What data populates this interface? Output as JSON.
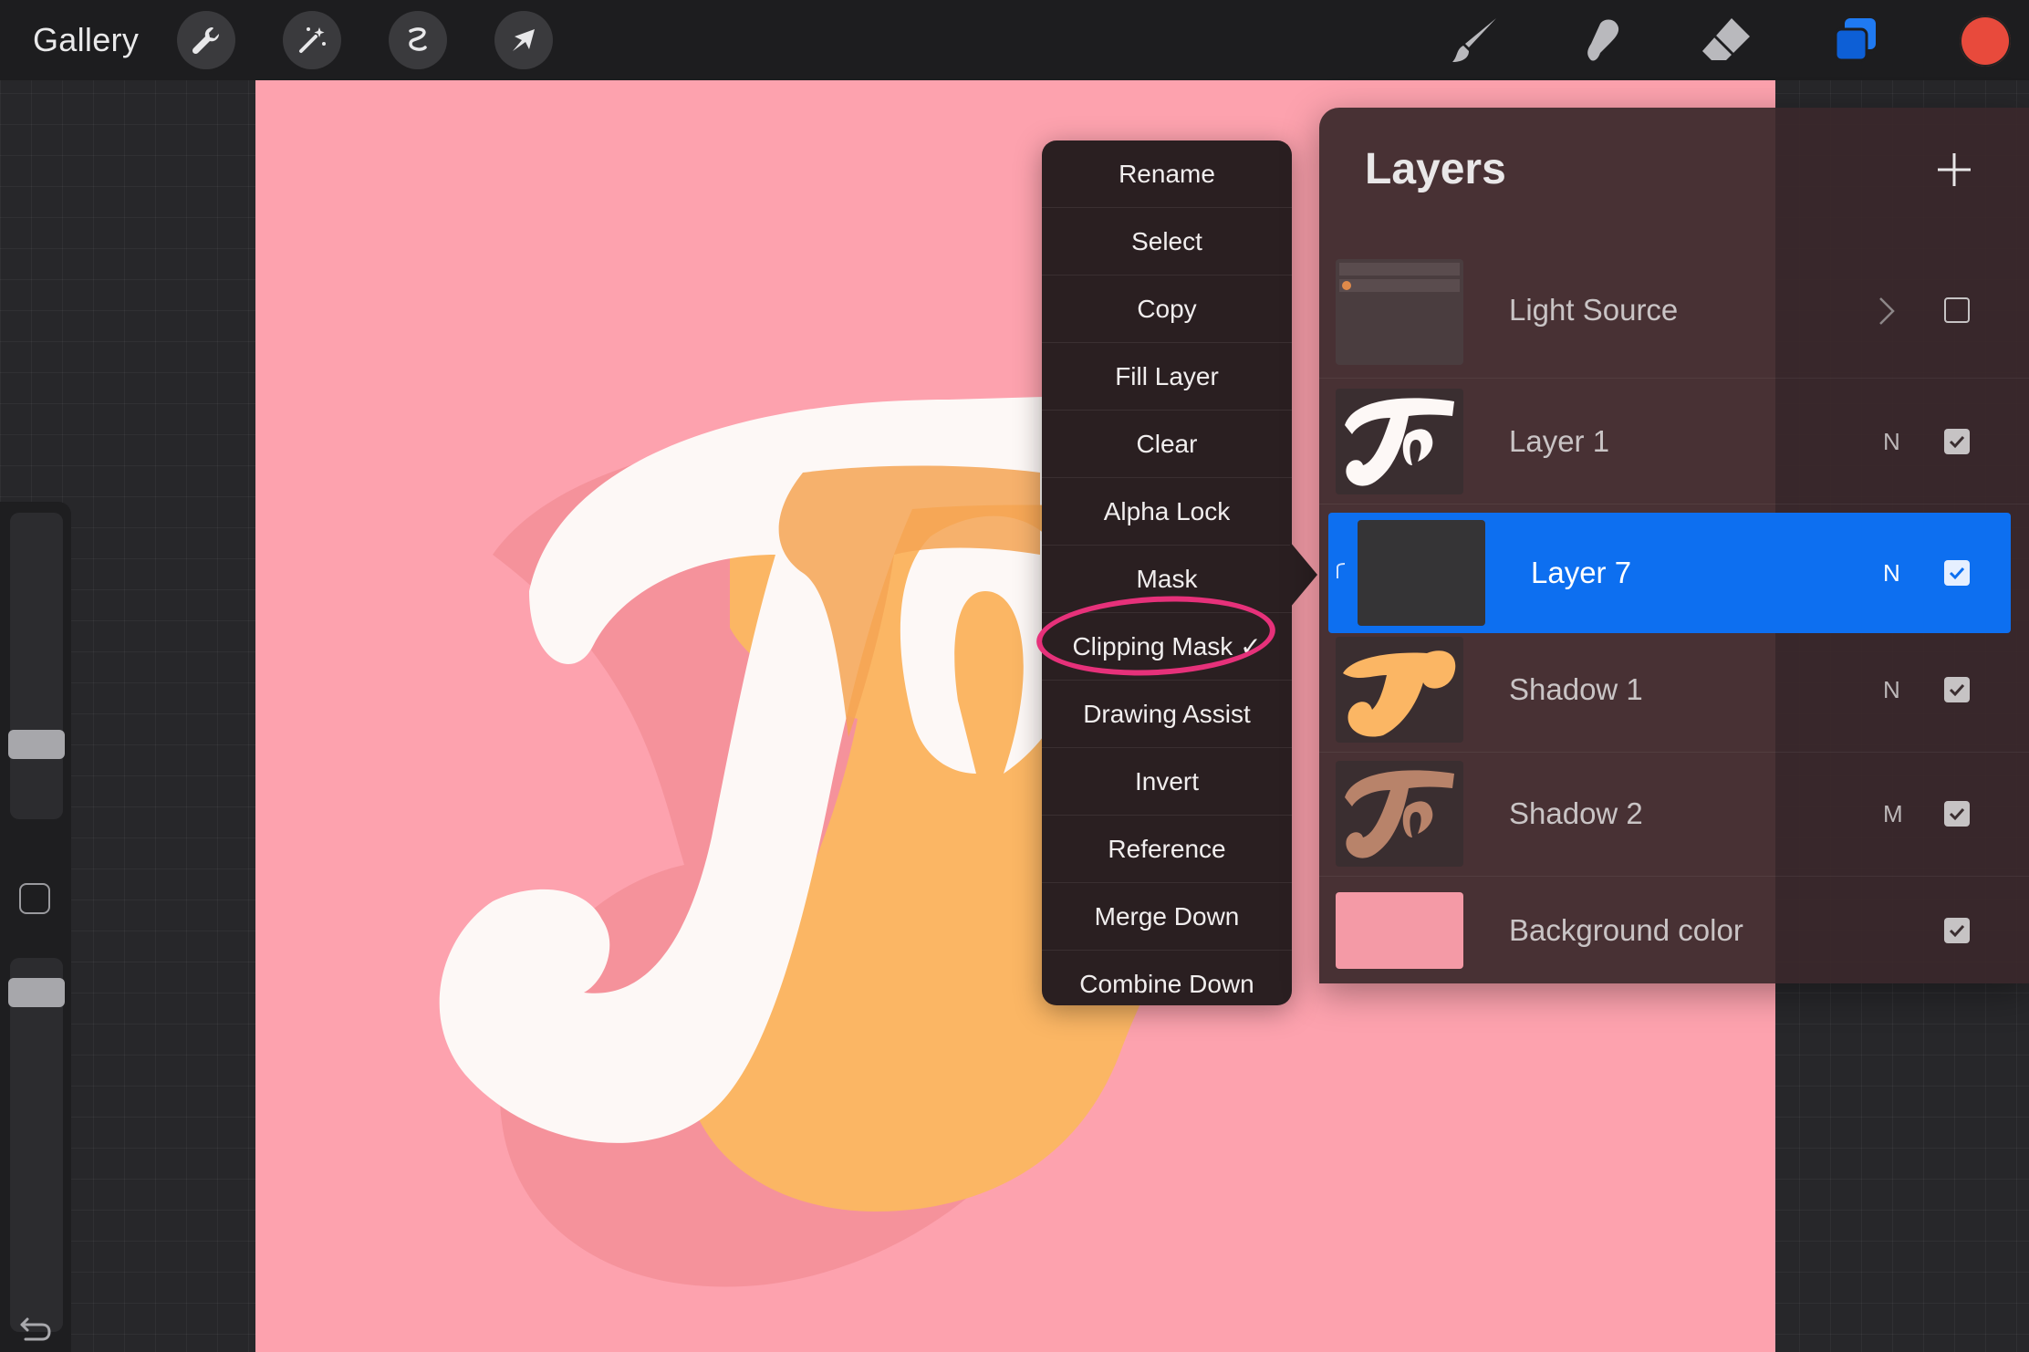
{
  "topbar": {
    "gallery_label": "Gallery",
    "tools_left": [
      "wrench-icon",
      "magic-wand-icon",
      "selection-icon",
      "transform-arrow-icon"
    ],
    "tools_right": [
      "brush-icon",
      "smudge-icon",
      "eraser-icon",
      "layers-icon"
    ],
    "active_color": "#e84a3c"
  },
  "canvas": {
    "background_color": "#fda2ae",
    "artwork_text": "Try"
  },
  "context_menu": {
    "items": [
      {
        "label": "Rename"
      },
      {
        "label": "Select"
      },
      {
        "label": "Copy"
      },
      {
        "label": "Fill Layer"
      },
      {
        "label": "Clear"
      },
      {
        "label": "Alpha Lock"
      },
      {
        "label": "Mask"
      },
      {
        "label": "Clipping Mask ✓"
      },
      {
        "label": "Drawing Assist"
      },
      {
        "label": "Invert"
      },
      {
        "label": "Reference"
      },
      {
        "label": "Merge Down"
      },
      {
        "label": "Combine Down"
      }
    ],
    "highlight_color": "#e6317a"
  },
  "layers_panel": {
    "title": "Layers",
    "layers": [
      {
        "name": "Light Source",
        "mode": "",
        "visible": false,
        "selected": false,
        "thumb_color": "#4a3d3f"
      },
      {
        "name": "Layer 1",
        "mode": "N",
        "visible": true,
        "selected": false,
        "thumb_color": "#3a2e30"
      },
      {
        "name": "Layer 7",
        "mode": "N",
        "visible": true,
        "selected": true,
        "thumb_color": "#353436"
      },
      {
        "name": "Shadow 1",
        "mode": "N",
        "visible": true,
        "selected": false,
        "thumb_color": "#3a2e30"
      },
      {
        "name": "Shadow 2",
        "mode": "M",
        "visible": true,
        "selected": false,
        "thumb_color": "#3a2e30"
      },
      {
        "name": "Background color",
        "mode": "",
        "visible": true,
        "selected": false,
        "thumb_color": "#f49aa6"
      }
    ],
    "selected_color": "#0d6ff0"
  }
}
